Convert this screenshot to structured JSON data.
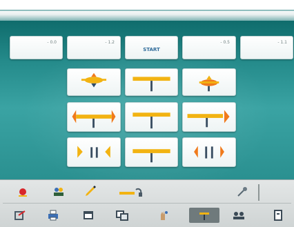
{
  "header": {
    "accent": "#8fbebe"
  },
  "value_tiles": [
    {
      "value": "- 0.0"
    },
    {
      "value": "- 1.2"
    },
    {
      "value": "START"
    },
    {
      "value": "- 0.5"
    },
    {
      "value": "- 1.1"
    }
  ],
  "adjustment_tiles": [
    {
      "icon": "camber-up-icon"
    },
    {
      "icon": "axle-level-icon"
    },
    {
      "icon": "camber-down-icon"
    },
    {
      "icon": "toe-out-icon"
    },
    {
      "icon": "axle-center-icon"
    },
    {
      "icon": "toe-in-icon"
    },
    {
      "icon": "wheels-inward-icon"
    },
    {
      "icon": "axle-flat-icon"
    },
    {
      "icon": "wheels-parallel-icon"
    }
  ],
  "colors": {
    "teal": "#248a8a",
    "accent_yellow": "#f2b312",
    "accent_orange": "#f07a1c",
    "start_text": "#2f6b9a"
  },
  "toolbar": {
    "row1": [
      "alert-icon",
      "team-icon",
      "pencil-icon",
      "link-icon",
      "tool-icon"
    ],
    "row2": [
      "exit-icon",
      "print-icon",
      "window-icon",
      "multi-window-icon",
      "hand-icon",
      "active-alignment-icon",
      "users-icon",
      "document-icon"
    ],
    "active_index": 5
  }
}
